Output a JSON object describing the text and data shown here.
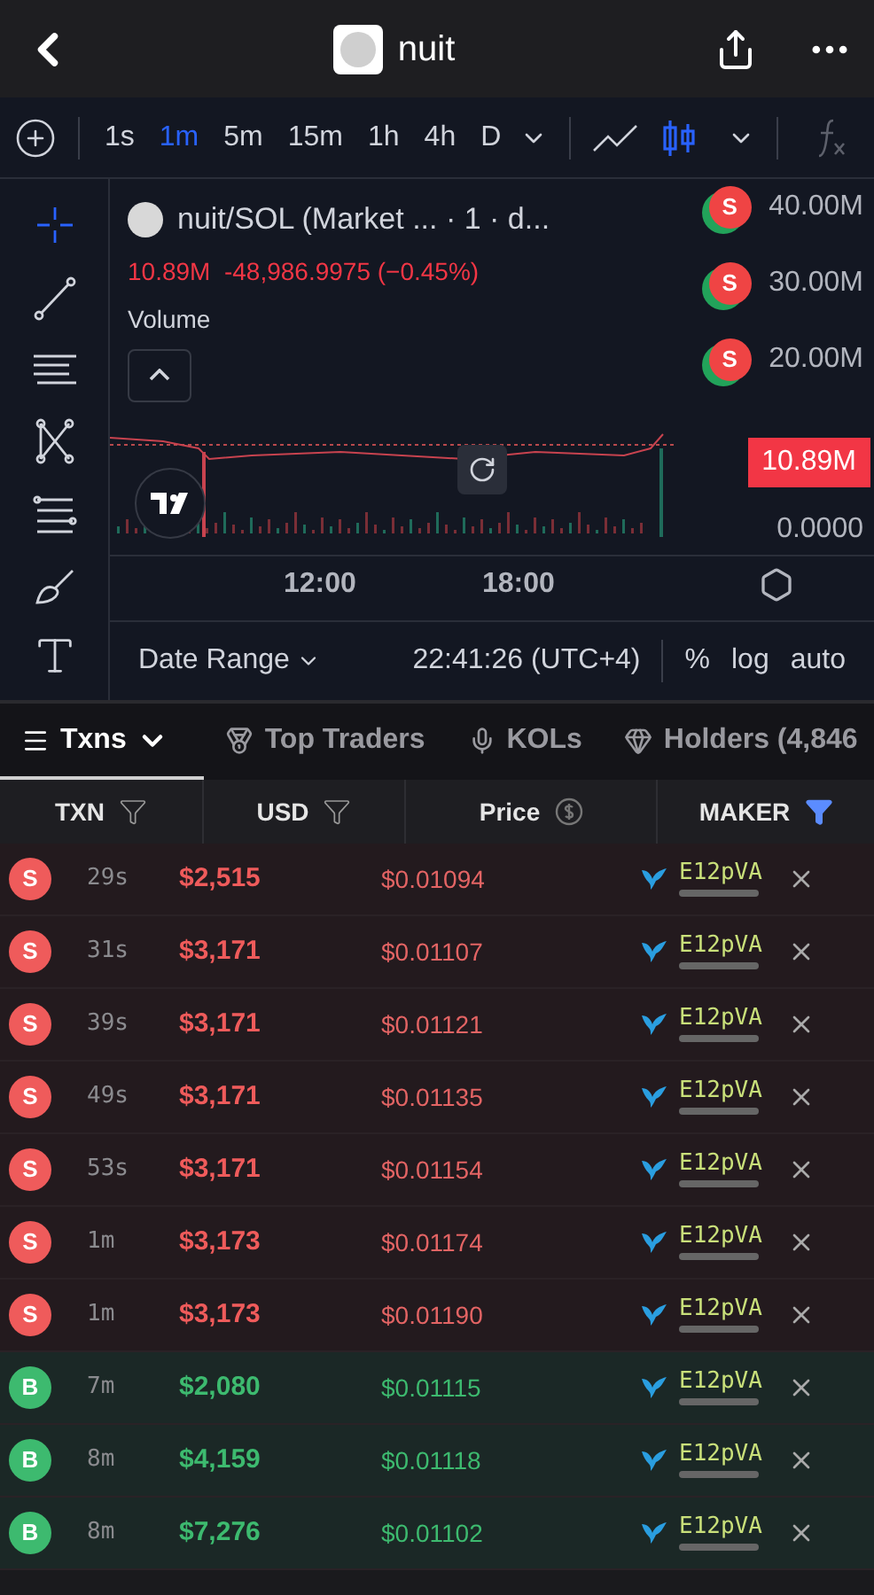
{
  "header": {
    "title": "nuit"
  },
  "toolbar": {
    "intervals": [
      {
        "label": "1s",
        "selected": false
      },
      {
        "label": "1m",
        "selected": true
      },
      {
        "label": "5m",
        "selected": false
      },
      {
        "label": "15m",
        "selected": false
      },
      {
        "label": "1h",
        "selected": false
      },
      {
        "label": "4h",
        "selected": false
      },
      {
        "label": "D",
        "selected": false
      }
    ]
  },
  "chart": {
    "symbol": "nuit/SOL (Market ... · 1 · d...",
    "stats": "10.89M  -48,986.9975 (−0.45%)",
    "indicator": "Volume",
    "y_labels": [
      "40.00M",
      "30.00M",
      "20.00M"
    ],
    "last_value": "10.89M",
    "zero_label": "0.0000",
    "x_labels": [
      "12:00",
      "18:00"
    ],
    "markers": [
      "S",
      "S",
      "S"
    ],
    "footer": {
      "date_range": "Date Range",
      "time": "22:41:26 (UTC+4)",
      "options": [
        "%",
        "log",
        "auto"
      ]
    }
  },
  "tabs": [
    {
      "label": "Txns",
      "selected": true
    },
    {
      "label": "Top Traders",
      "selected": false
    },
    {
      "label": "KOLs",
      "selected": false
    },
    {
      "label": "Holders (4,846",
      "selected": false
    }
  ],
  "table": {
    "columns": [
      {
        "label": "TXN",
        "kind": "filter"
      },
      {
        "label": "USD",
        "kind": "filter"
      },
      {
        "label": "Price",
        "kind": "coin"
      },
      {
        "label": "MAKER",
        "kind": "activefilter"
      }
    ],
    "rows": [
      {
        "side": "S",
        "kind": "sell",
        "age": "29s",
        "usd": "$2,515",
        "price": "$0.01094",
        "maker": "E12pVA"
      },
      {
        "side": "S",
        "kind": "sell",
        "age": "31s",
        "usd": "$3,171",
        "price": "$0.01107",
        "maker": "E12pVA"
      },
      {
        "side": "S",
        "kind": "sell",
        "age": "39s",
        "usd": "$3,171",
        "price": "$0.01121",
        "maker": "E12pVA"
      },
      {
        "side": "S",
        "kind": "sell",
        "age": "49s",
        "usd": "$3,171",
        "price": "$0.01135",
        "maker": "E12pVA"
      },
      {
        "side": "S",
        "kind": "sell",
        "age": "53s",
        "usd": "$3,171",
        "price": "$0.01154",
        "maker": "E12pVA"
      },
      {
        "side": "S",
        "kind": "sell",
        "age": "1m",
        "usd": "$3,173",
        "price": "$0.01174",
        "maker": "E12pVA"
      },
      {
        "side": "S",
        "kind": "sell",
        "age": "1m",
        "usd": "$3,173",
        "price": "$0.01190",
        "maker": "E12pVA"
      },
      {
        "side": "B",
        "kind": "buy",
        "age": "7m",
        "usd": "$2,080",
        "price": "$0.01115",
        "maker": "E12pVA"
      },
      {
        "side": "B",
        "kind": "buy",
        "age": "8m",
        "usd": "$4,159",
        "price": "$0.01118",
        "maker": "E12pVA"
      },
      {
        "side": "B",
        "kind": "buy",
        "age": "8m",
        "usd": "$7,276",
        "price": "$0.01102",
        "maker": "E12pVA"
      }
    ]
  }
}
